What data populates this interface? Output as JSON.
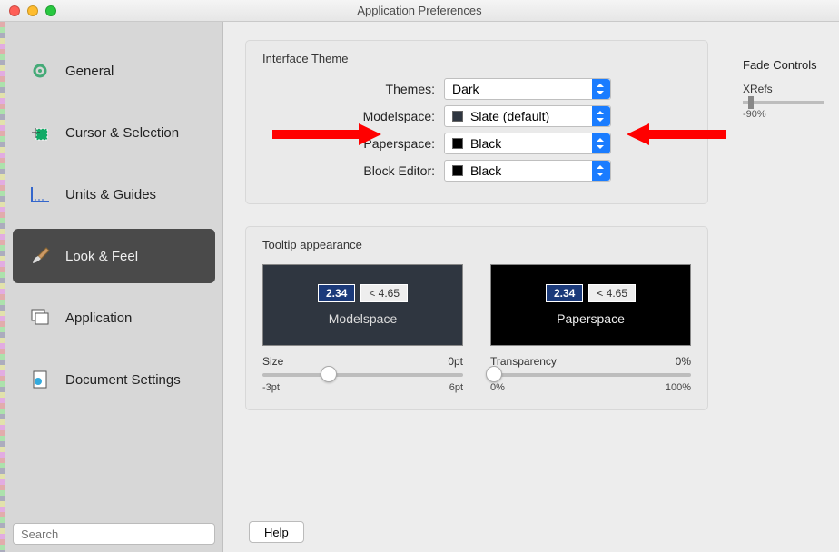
{
  "window": {
    "title": "Application Preferences"
  },
  "sidebar": {
    "items": [
      {
        "label": "General"
      },
      {
        "label": "Cursor & Selection"
      },
      {
        "label": "Units & Guides"
      },
      {
        "label": "Look & Feel"
      },
      {
        "label": "Application"
      },
      {
        "label": "Document Settings"
      }
    ],
    "search_placeholder": "Search"
  },
  "theme": {
    "group_title": "Interface Theme",
    "rows": {
      "themes_label": "Themes:",
      "themes_value": "Dark",
      "modelspace_label": "Modelspace:",
      "modelspace_value": "Slate (default)",
      "paperspace_label": "Paperspace:",
      "paperspace_value": "Black",
      "blockeditor_label": "Block Editor:",
      "blockeditor_value": "Black"
    }
  },
  "tooltip": {
    "group_title": "Tooltip appearance",
    "ms_name": "Modelspace",
    "ps_name": "Paperspace",
    "num_a": "2.34",
    "num_b": "< 4.65",
    "size_label": "Size",
    "size_value": "0pt",
    "size_min": "-3pt",
    "size_max": "6pt",
    "trans_label": "Transparency",
    "trans_value": "0%",
    "trans_min": "0%",
    "trans_max": "100%"
  },
  "fade": {
    "title": "Fade Controls",
    "item1": "XRefs",
    "value1": "-90%"
  },
  "buttons": {
    "help": "Help"
  }
}
